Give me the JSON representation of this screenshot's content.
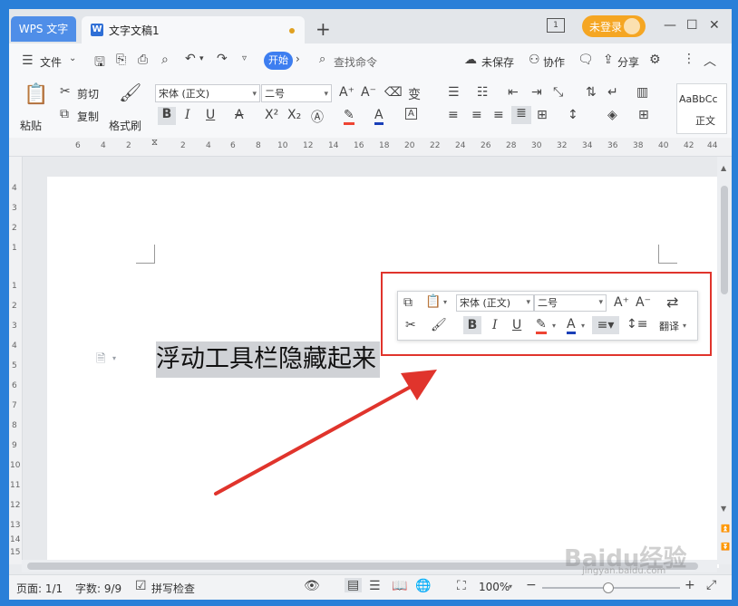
{
  "titlebar": {
    "app_tab": "WPS 文字",
    "doc_tab": "文字文稿1",
    "login_label": "未登录"
  },
  "menubar": {
    "file_label": "文件",
    "start_label": "开始",
    "search_placeholder": "查找命令",
    "unsaved_label": "未保存",
    "collab_label": "协作",
    "share_label": "分享"
  },
  "ribbon": {
    "paste_label": "粘贴",
    "cut_label": "剪切",
    "copy_label": "复制",
    "format_painter_label": "格式刷",
    "font_name": "宋体 (正文)",
    "font_size": "二号",
    "style_preview": "AaBbCc",
    "style_name": "正文"
  },
  "ruler_top": [
    "6",
    "4",
    "2",
    "2",
    "4",
    "6",
    "8",
    "10",
    "12",
    "14",
    "16",
    "18",
    "20",
    "22",
    "24",
    "26",
    "28",
    "30",
    "32",
    "34",
    "36",
    "38",
    "40",
    "42",
    "44"
  ],
  "ruler_left": [
    "4",
    "3",
    "2",
    "1",
    "1",
    "2",
    "3",
    "4",
    "5",
    "6",
    "7",
    "8",
    "9",
    "10",
    "11",
    "12",
    "13",
    "14",
    "15"
  ],
  "document": {
    "selected_text": "浮动工具栏隐藏起来"
  },
  "float_toolbar": {
    "font_name": "宋体 (正文)",
    "font_size": "二号",
    "translate_label": "翻译"
  },
  "statusbar": {
    "page": "页面: 1/1",
    "word_count": "字数: 9/9",
    "spellcheck": "拼写检查",
    "zoom": "100%"
  },
  "watermark": {
    "brand": "Baidu经验",
    "url": "jingyan.baidu.com"
  },
  "colors": {
    "accent_blue": "#3d7ef0",
    "annotation_red": "#e0342c",
    "login_orange": "#f5a623"
  }
}
